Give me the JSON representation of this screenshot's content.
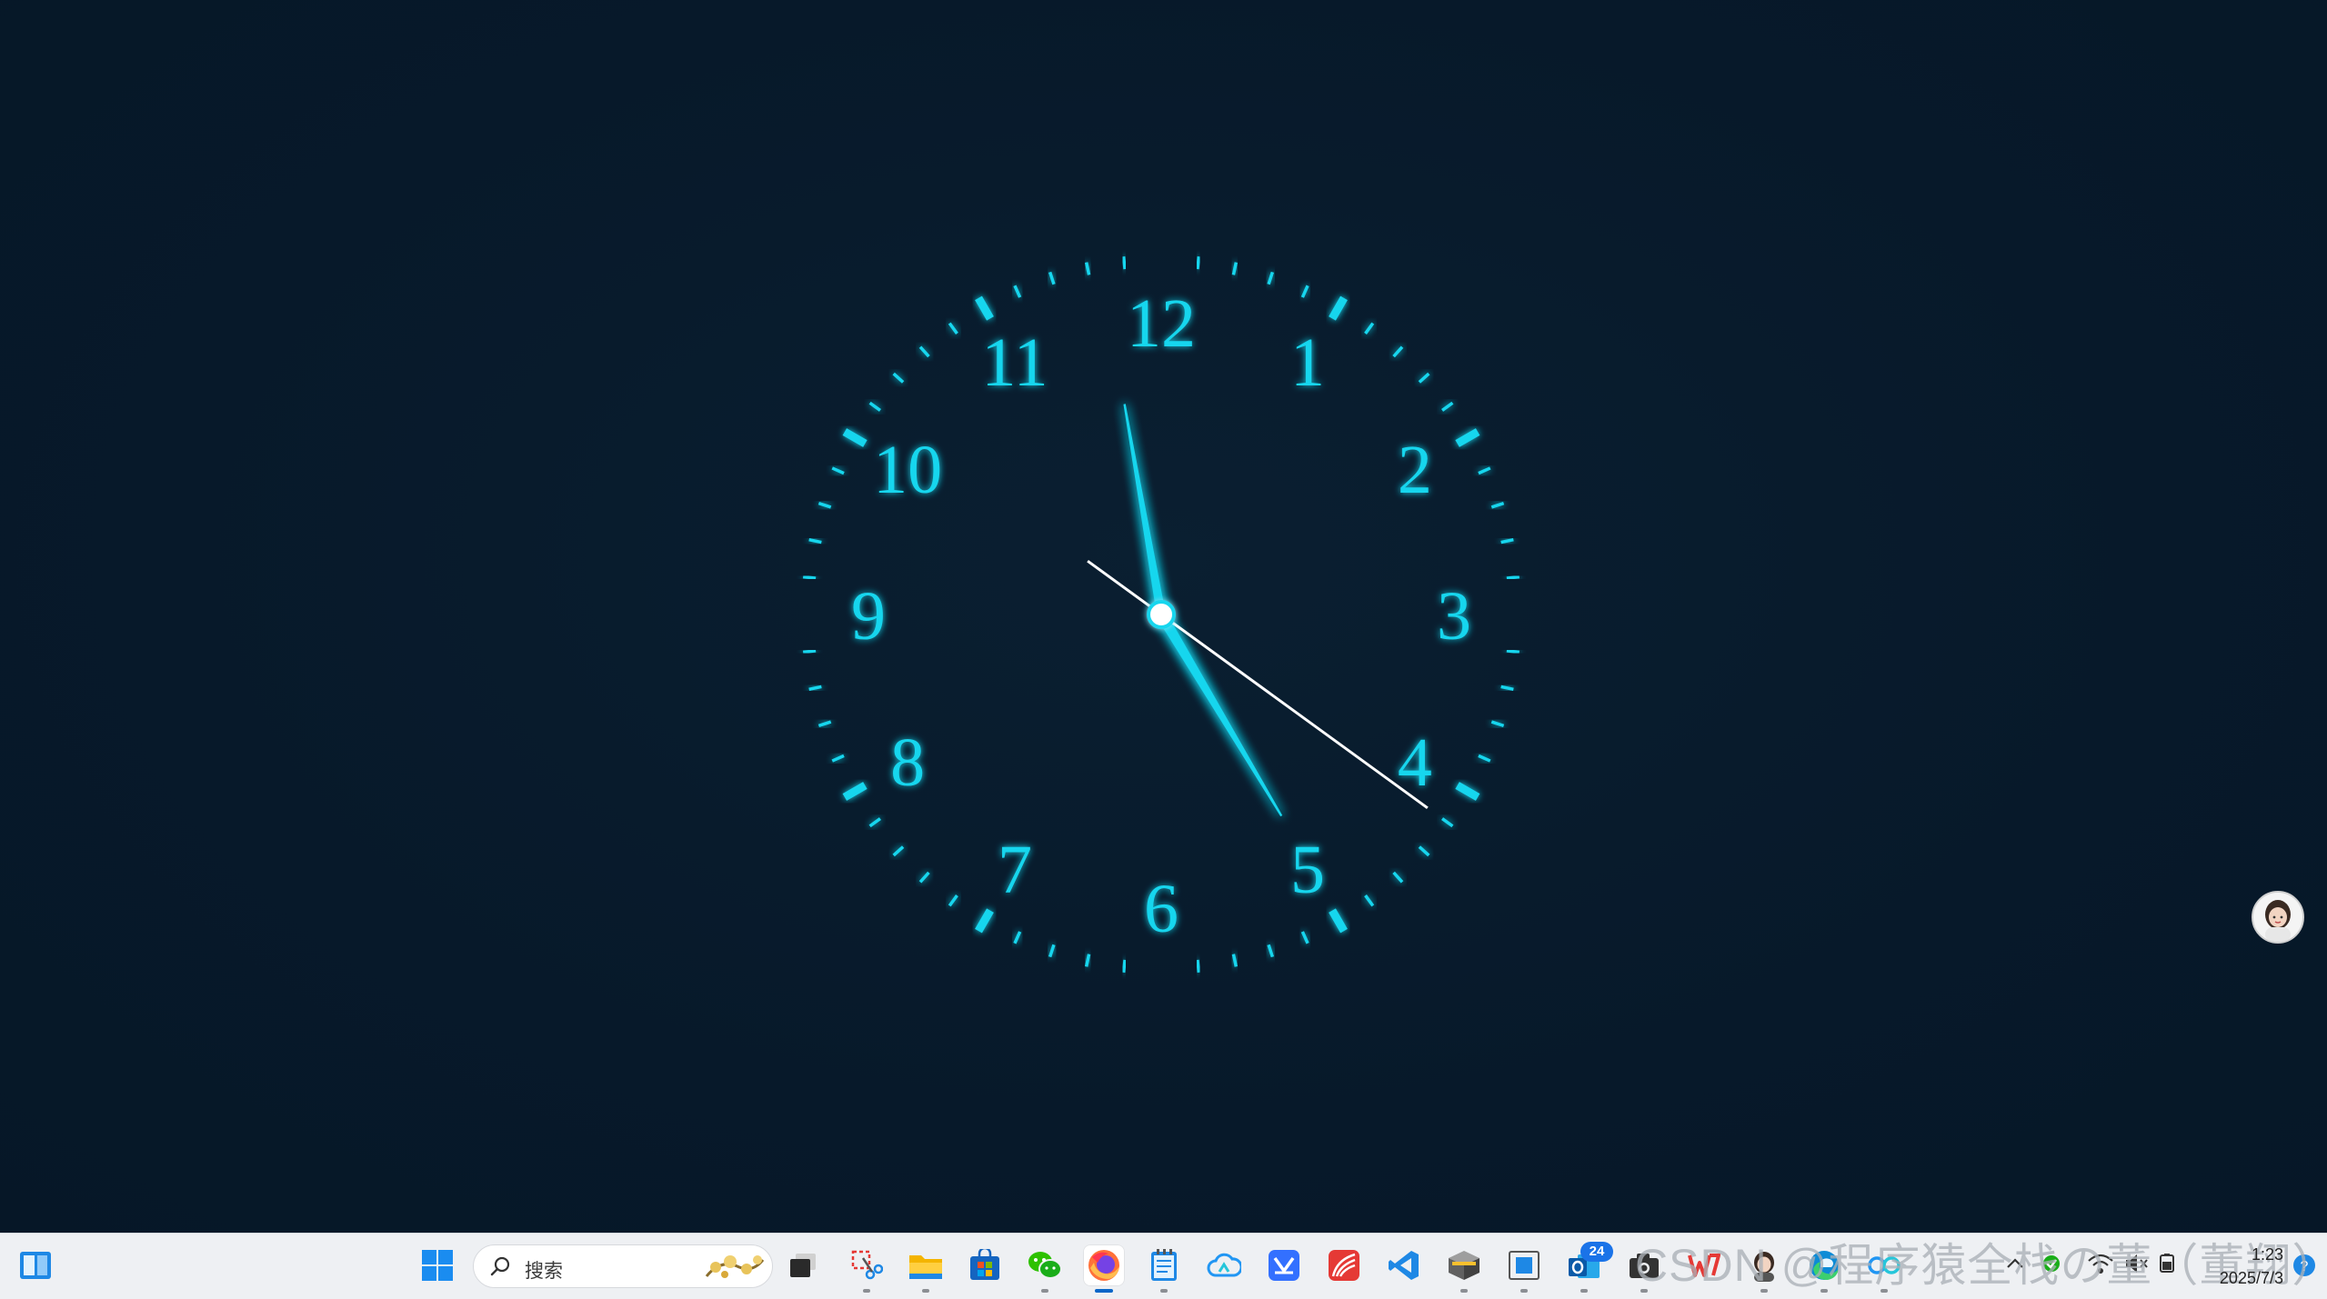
{
  "clock": {
    "numerals": [
      "12",
      "1",
      "2",
      "3",
      "4",
      "5",
      "6",
      "7",
      "8",
      "9",
      "10",
      "11"
    ],
    "time": {
      "hour": 4,
      "minute": 58,
      "second": 21
    },
    "colors": {
      "accent": "#18d6ee",
      "second_hand": "#ffffff",
      "background": "#07192a"
    }
  },
  "taskbar": {
    "search_placeholder": "搜索",
    "icons": [
      {
        "name": "widgets-icon"
      },
      {
        "name": "start-icon"
      },
      {
        "name": "search-decor-icon"
      },
      {
        "name": "task-view-icon"
      },
      {
        "name": "snipping-tool-icon"
      },
      {
        "name": "file-explorer-icon"
      },
      {
        "name": "microsoft-store-icon"
      },
      {
        "name": "wechat-icon"
      },
      {
        "name": "firefox-icon"
      },
      {
        "name": "notepad-icon"
      },
      {
        "name": "baidu-netdisk-icon"
      },
      {
        "name": "lark-icon"
      },
      {
        "name": "xuexitong-icon"
      },
      {
        "name": "vscode-icon"
      },
      {
        "name": "package-app-icon"
      },
      {
        "name": "window-app-icon"
      },
      {
        "name": "outlook-icon"
      },
      {
        "name": "camera-app-icon"
      },
      {
        "name": "wps-icon"
      },
      {
        "name": "avatar-app-icon"
      },
      {
        "name": "edge-icon"
      },
      {
        "name": "copilot-icon"
      }
    ],
    "notification_badge": "24",
    "watermark": "CSDN @程序猿全栈の董（董翔）",
    "tray": {
      "time": "1:23",
      "date": "2025/7/3",
      "icons": [
        "chevron-up-icon",
        "check-icon",
        "wifi-icon",
        "volume-icon",
        "battery-icon",
        "help-icon"
      ]
    }
  }
}
